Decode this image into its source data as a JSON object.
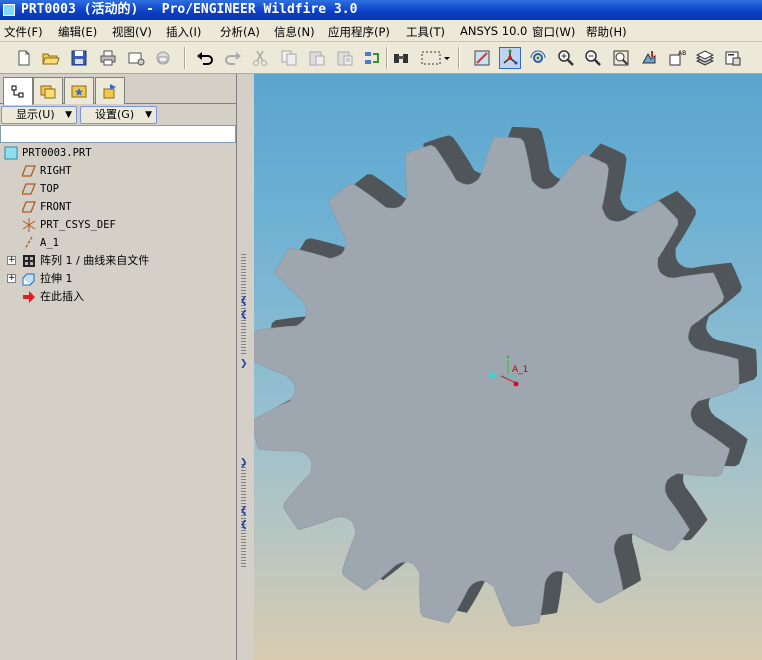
{
  "window": {
    "title": "PRT0003 (活动的) - Pro/ENGINEER Wildfire 3.0"
  },
  "menu": [
    "文件(F)",
    "编辑(E)",
    "视图(V)",
    "插入(I)",
    "分析(A)",
    "信息(N)",
    "应用程序(P)",
    "工具(T)",
    "ANSYS 10.0",
    "窗口(W)",
    "帮助(H)"
  ],
  "toolbar_icons": [
    "new-icon",
    "open-icon",
    "save-icon",
    "print-icon",
    "email-icon",
    "send-icon",
    "undo-icon",
    "redo-icon",
    "cut-icon",
    "copy-icon",
    "paste-icon",
    "paste-special-icon",
    "regenerate-icon",
    "find-icon",
    "select-box-icon",
    "view-repaint-icon",
    "spin-center-icon",
    "orient-mode-icon",
    "zoom-in-icon",
    "zoom-out-icon",
    "refit-icon",
    "reorient-icon",
    "saved-views-icon",
    "layers-icon",
    "view-manager-icon"
  ],
  "panel": {
    "show_button": "显示(U)",
    "settings_button": "设置(G)"
  },
  "tree": {
    "root": "PRT0003.PRT",
    "items": [
      {
        "label": "RIGHT",
        "icon": "datum-plane-icon"
      },
      {
        "label": "TOP",
        "icon": "datum-plane-icon"
      },
      {
        "label": "FRONT",
        "icon": "datum-plane-icon"
      },
      {
        "label": "PRT_CSYS_DEF",
        "icon": "csys-icon"
      },
      {
        "label": "A_1",
        "icon": "datum-axis-icon"
      },
      {
        "label": "阵列 1 / 曲线来自文件",
        "icon": "pattern-icon"
      },
      {
        "label": "拉伸 1",
        "icon": "extrude-icon"
      },
      {
        "label": "在此插入",
        "icon": "insert-here-arrow-icon"
      }
    ]
  },
  "viewport": {
    "axis_label": "A_1",
    "model": "spur-gear"
  }
}
